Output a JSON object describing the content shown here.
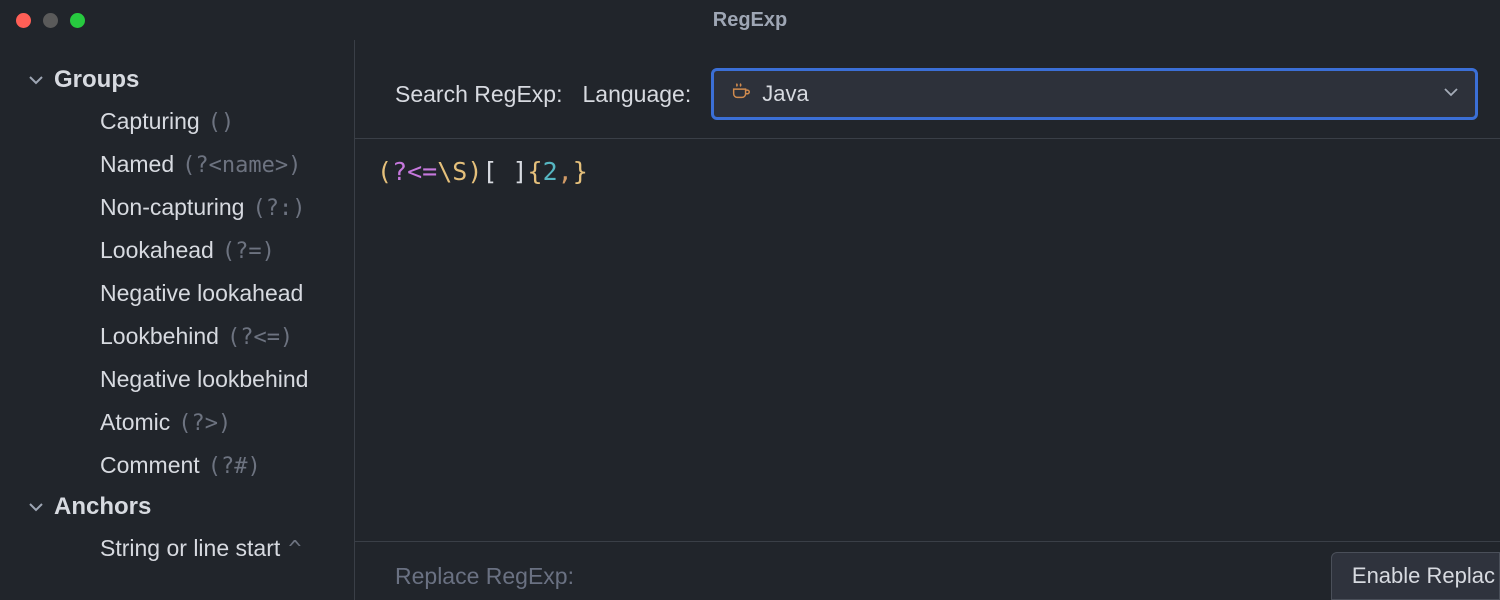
{
  "window": {
    "title": "RegExp"
  },
  "sidebar": {
    "sections": [
      {
        "title": "Groups",
        "items": [
          {
            "label": "Capturing",
            "hint": "()"
          },
          {
            "label": "Named",
            "hint": "(?<name>)"
          },
          {
            "label": "Non-capturing",
            "hint": "(?:)"
          },
          {
            "label": "Lookahead",
            "hint": "(?=)"
          },
          {
            "label": "Negative lookahead",
            "hint": ""
          },
          {
            "label": "Lookbehind",
            "hint": "(?<=)"
          },
          {
            "label": "Negative lookbehind",
            "hint": ""
          },
          {
            "label": "Atomic",
            "hint": "(?>)"
          },
          {
            "label": "Comment",
            "hint": "(?#)"
          }
        ]
      },
      {
        "title": "Anchors",
        "items": [
          {
            "label": "String or line start",
            "hint": "^"
          }
        ]
      }
    ]
  },
  "search": {
    "label": "Search RegExp:",
    "languageLabel": "Language:",
    "languageValue": "Java"
  },
  "regex": {
    "p1": "(",
    "p2": "?<=",
    "p3": "\\S",
    "p4": ")",
    "p5": "[ ]",
    "p6": "{",
    "p7": "2",
    "p8": ",",
    "p9": "}"
  },
  "footer": {
    "replaceLabel": "Replace RegExp:",
    "enableButton": "Enable Replac"
  }
}
